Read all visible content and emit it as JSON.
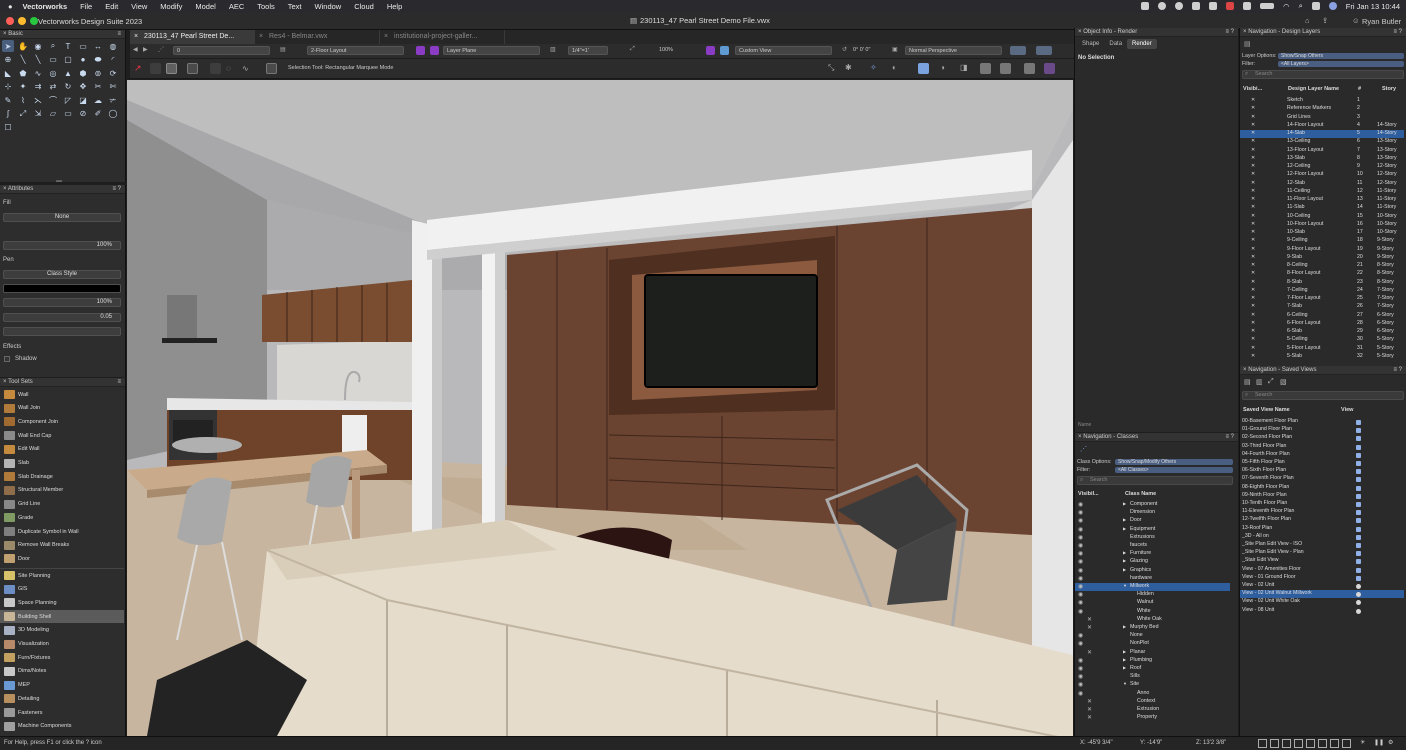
{
  "menubar": {
    "app": "Vectorworks",
    "items": [
      "File",
      "Edit",
      "View",
      "Modify",
      "Model",
      "AEC",
      "Tools",
      "Text",
      "Window",
      "Cloud",
      "Help"
    ],
    "clock": "Fri Jan 13  10:44"
  },
  "titlebar": {
    "app_title": "Vectorworks Design Suite 2023",
    "doc_title": "230113_47 Pearl Street Demo File.vwx",
    "user": "Ryan Butler"
  },
  "tabs": [
    {
      "label": "230113_47 Pearl Street De..."
    },
    {
      "label": "Res4 - Belmar.vwx"
    },
    {
      "label": "institutional-project-galler..."
    }
  ],
  "viewbar": {
    "class": "0",
    "layer": "2-Floor Layout",
    "plane": "Layer Plane",
    "scale": "1/4\"=1'",
    "zoom": "100%",
    "view": "Custom View",
    "rotation": "0° 0' 0\"",
    "render": "Normal Perspective"
  },
  "modebar": {
    "hint": "Selection Tool: Rectangular Marquee Mode"
  },
  "basic_palette": {
    "title": "Basic"
  },
  "attributes": {
    "title": "Attributes",
    "fill_label": "Fill",
    "fill_value": "None",
    "fill_opacity": "100%",
    "pen_label": "Pen",
    "pen_value": "Class Style",
    "pen_opacity": "100%",
    "line_weight": "0.05",
    "effects_label": "Effects",
    "shadow_label": "Shadow"
  },
  "toolsets": {
    "title": "Tool Sets",
    "tools": [
      "Wall",
      "Wall Join",
      "Component Join",
      "Wall End Cap",
      "Edit Wall",
      "Slab",
      "Slab Drainage",
      "Structural Member",
      "Grid Line",
      "Grade",
      "Duplicate Symbol in Wall",
      "Remove Wall Breaks",
      "Door"
    ],
    "sets": [
      "Site Planning",
      "GIS",
      "Space Planning",
      "Building Shell",
      "3D Modeling",
      "Visualization",
      "Furn/Fixtures",
      "Dims/Notes",
      "MEP",
      "Detailing",
      "Fasteners",
      "Machine Components"
    ],
    "selected_set": "Building Shell"
  },
  "object_info": {
    "title": "Object Info - Render",
    "tabs": [
      "Shape",
      "Data",
      "Render"
    ],
    "active_tab": "Render",
    "selection": "No Selection",
    "name_label": "Name"
  },
  "classes": {
    "title": "Navigation - Classes",
    "options_label": "Class Options:",
    "options_value": "Show/Snap/Modify Others",
    "filter_label": "Filter:",
    "filter_value": "<All Classes>",
    "search_placeholder": "Search",
    "col_visibility": "Visibil...",
    "col_name": "Class Name",
    "rows": [
      {
        "name": "Component",
        "indent": 1,
        "arrow": "▶",
        "vis": "eye"
      },
      {
        "name": "Dimension",
        "indent": 1,
        "arrow": "",
        "vis": "eye"
      },
      {
        "name": "Door",
        "indent": 1,
        "arrow": "▶",
        "vis": "eye"
      },
      {
        "name": "Equipment",
        "indent": 1,
        "arrow": "▶",
        "vis": "eye"
      },
      {
        "name": "Extrusions",
        "indent": 1,
        "arrow": "",
        "vis": "eye"
      },
      {
        "name": "faucets",
        "indent": 1,
        "arrow": "",
        "vis": "eye"
      },
      {
        "name": "Furniture",
        "indent": 1,
        "arrow": "▶",
        "vis": "eye"
      },
      {
        "name": "Glazing",
        "indent": 1,
        "arrow": "▶",
        "vis": "eye"
      },
      {
        "name": "Graphics",
        "indent": 1,
        "arrow": "▶",
        "vis": "eye"
      },
      {
        "name": "hardware",
        "indent": 1,
        "arrow": "",
        "vis": "eye"
      },
      {
        "name": "Millwork",
        "indent": 1,
        "arrow": "▼",
        "vis": "eye",
        "sel": true
      },
      {
        "name": "Hidden",
        "indent": 2,
        "arrow": "",
        "vis": "eye"
      },
      {
        "name": "Walnut",
        "indent": 2,
        "arrow": "",
        "vis": "eye"
      },
      {
        "name": "White",
        "indent": 2,
        "arrow": "",
        "vis": "eye"
      },
      {
        "name": "White Oak",
        "indent": 2,
        "arrow": "",
        "vis": "x"
      },
      {
        "name": "Murphy Bed",
        "indent": 1,
        "arrow": "▶",
        "vis": "x"
      },
      {
        "name": "None",
        "indent": 1,
        "arrow": "",
        "vis": "eye"
      },
      {
        "name": "NonPlot",
        "indent": 1,
        "arrow": "",
        "vis": "eye"
      },
      {
        "name": "Planar",
        "indent": 1,
        "arrow": "▶",
        "vis": "x"
      },
      {
        "name": "Plumbing",
        "indent": 1,
        "arrow": "▶",
        "vis": "eye"
      },
      {
        "name": "Roof",
        "indent": 1,
        "arrow": "▶",
        "vis": "eye"
      },
      {
        "name": "Sills",
        "indent": 1,
        "arrow": "",
        "vis": "eye"
      },
      {
        "name": "Site",
        "indent": 1,
        "arrow": "▼",
        "vis": "eye"
      },
      {
        "name": "Anno",
        "indent": 2,
        "arrow": "",
        "vis": "eye"
      },
      {
        "name": "Context",
        "indent": 2,
        "arrow": "",
        "vis": "x"
      },
      {
        "name": "Extrusion",
        "indent": 2,
        "arrow": "",
        "vis": "x"
      },
      {
        "name": "Property",
        "indent": 2,
        "arrow": "",
        "vis": "x"
      }
    ]
  },
  "layers": {
    "title": "Navigation - Design Layers",
    "options_label": "Layer Options:",
    "options_value": "Show/Snap Others",
    "filter_label": "Filter:",
    "filter_value": "<All Layers>",
    "search_placeholder": "Search",
    "col_visibility": "Visibi...",
    "col_name": "Design Layer Name",
    "col_num": "#",
    "col_story": "Story",
    "rows": [
      {
        "name": "Sketch",
        "num": "1",
        "story": ""
      },
      {
        "name": "Reference Markers",
        "num": "2",
        "story": ""
      },
      {
        "name": "Grid Lines",
        "num": "3",
        "story": ""
      },
      {
        "name": "14-Floor Layout",
        "num": "4",
        "story": "14-Story"
      },
      {
        "name": "14-Slab",
        "num": "5",
        "story": "14-Story",
        "sel": true
      },
      {
        "name": "13-Ceiling",
        "num": "6",
        "story": "13-Story"
      },
      {
        "name": "13-Floor Layout",
        "num": "7",
        "story": "13-Story"
      },
      {
        "name": "13-Slab",
        "num": "8",
        "story": "13-Story"
      },
      {
        "name": "12-Ceiling",
        "num": "9",
        "story": "12-Story"
      },
      {
        "name": "12-Floor Layout",
        "num": "10",
        "story": "12-Story"
      },
      {
        "name": "12-Slab",
        "num": "11",
        "story": "12-Story"
      },
      {
        "name": "11-Ceiling",
        "num": "12",
        "story": "11-Story"
      },
      {
        "name": "11-Floor Layout",
        "num": "13",
        "story": "11-Story"
      },
      {
        "name": "11-Slab",
        "num": "14",
        "story": "11-Story"
      },
      {
        "name": "10-Ceiling",
        "num": "15",
        "story": "10-Story"
      },
      {
        "name": "10-Floor Layout",
        "num": "16",
        "story": "10-Story"
      },
      {
        "name": "10-Slab",
        "num": "17",
        "story": "10-Story"
      },
      {
        "name": "9-Ceiling",
        "num": "18",
        "story": "9-Story"
      },
      {
        "name": "9-Floor Layout",
        "num": "19",
        "story": "9-Story"
      },
      {
        "name": "9-Slab",
        "num": "20",
        "story": "9-Story"
      },
      {
        "name": "8-Ceiling",
        "num": "21",
        "story": "8-Story"
      },
      {
        "name": "8-Floor Layout",
        "num": "22",
        "story": "8-Story"
      },
      {
        "name": "8-Slab",
        "num": "23",
        "story": "8-Story"
      },
      {
        "name": "7-Ceiling",
        "num": "24",
        "story": "7-Story"
      },
      {
        "name": "7-Floor Layout",
        "num": "25",
        "story": "7-Story"
      },
      {
        "name": "7-Slab",
        "num": "26",
        "story": "7-Story"
      },
      {
        "name": "6-Ceiling",
        "num": "27",
        "story": "6-Story"
      },
      {
        "name": "6-Floor Layout",
        "num": "28",
        "story": "6-Story"
      },
      {
        "name": "6-Slab",
        "num": "29",
        "story": "6-Story"
      },
      {
        "name": "5-Ceiling",
        "num": "30",
        "story": "5-Story"
      },
      {
        "name": "5-Floor Layout",
        "num": "31",
        "story": "5-Story"
      },
      {
        "name": "5-Slab",
        "num": "32",
        "story": "5-Story"
      }
    ]
  },
  "saved_views": {
    "title": "Navigation - Saved Views",
    "search_placeholder": "Search",
    "col_name": "Saved View Name",
    "col_view": "View",
    "rows": [
      {
        "name": "00-Basement Floor Plan"
      },
      {
        "name": "01-Ground Floor Plan"
      },
      {
        "name": "02-Second Floor Plan"
      },
      {
        "name": "03-Third Floor Plan"
      },
      {
        "name": "04-Fourth Floor Plan"
      },
      {
        "name": "05-Fifth Floor Plan"
      },
      {
        "name": "06-Sixth Floor Plan"
      },
      {
        "name": "07-Seventh Floor Plan"
      },
      {
        "name": "08-Eighth Floor Plan"
      },
      {
        "name": "09-Ninth Floor Plan"
      },
      {
        "name": "10-Tenth Floor Plan"
      },
      {
        "name": "11-Eleventh Floor Plan"
      },
      {
        "name": "12-Twelfth Floor Plan"
      },
      {
        "name": "13-Roof Plan"
      },
      {
        "name": "_3D - All on"
      },
      {
        "name": "_Site Plan Edit View - ISO"
      },
      {
        "name": "_Site Plan Edit View - Plan"
      },
      {
        "name": "_Stair Edit View"
      },
      {
        "name": "View - 07 Amenities Floor"
      },
      {
        "name": "View - 01 Ground Floor"
      },
      {
        "name": "View - 02 Unit"
      },
      {
        "name": "View - 02 Unit Walnut Millwork",
        "sel": true
      },
      {
        "name": "View - 02 Unit White Oak"
      },
      {
        "name": "View - 08 Unit"
      }
    ]
  },
  "statusbar": {
    "help": "For Help, press F1 or click the ? icon",
    "x": "X: -45'9 3/4\"",
    "y": "Y: -14'9\"",
    "z": "Z: 13'2 3/8\""
  },
  "colors": {
    "selection": "#2f5e9e",
    "walnut": "#6a4330",
    "floor": "#c9b7a2",
    "sofa": "#e6dccb"
  }
}
